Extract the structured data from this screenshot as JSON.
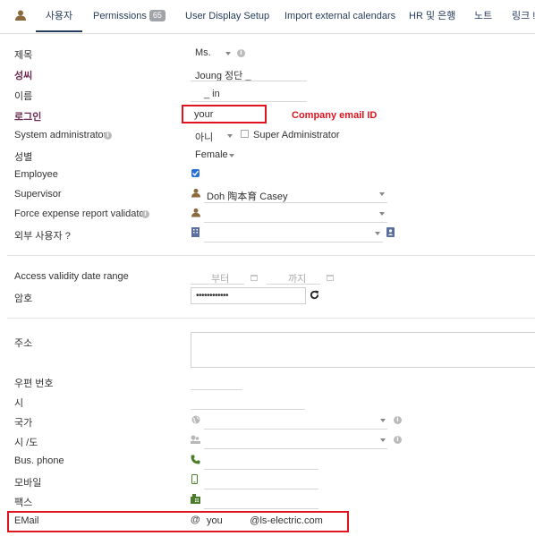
{
  "tabs": [
    {
      "label": "사용자",
      "active": true
    },
    {
      "label": "Permissions",
      "badge": "65"
    },
    {
      "label": "User Display Setup"
    },
    {
      "label": "Import external calendars"
    },
    {
      "label": "HR 및 은행"
    },
    {
      "label": "노트"
    },
    {
      "label": "링크 !"
    }
  ],
  "fields": {
    "title": {
      "label": "제목",
      "value": "Ms."
    },
    "lastname": {
      "label": "성씨",
      "value": "Joung 정단 _"
    },
    "firstname": {
      "label": "이름",
      "value": "_ in"
    },
    "login": {
      "label": "로그인",
      "value": "your"
    },
    "sysadmin": {
      "label": "System administrator",
      "value": "아니",
      "superadmin": "Super Administrator"
    },
    "gender": {
      "label": "성별",
      "value": "Female"
    },
    "employee": {
      "label": "Employee"
    },
    "supervisor": {
      "label": "Supervisor",
      "value": "Doh 陶本育 Casey"
    },
    "expense_validator": {
      "label": "Force expense report validator",
      "value": ""
    },
    "external_user": {
      "label": "외부 사용자 ?",
      "value": ""
    },
    "validity": {
      "label": "Access validity date range",
      "from": "부터",
      "to": "까지"
    },
    "password": {
      "label": "암호",
      "value": "••••••••••••"
    },
    "address": {
      "label": "주소",
      "value": ""
    },
    "zip": {
      "label": "우편 번호",
      "value": ""
    },
    "city": {
      "label": "시",
      "value": ""
    },
    "country": {
      "label": "국가",
      "value": ""
    },
    "state": {
      "label": "시 /도",
      "value": ""
    },
    "bus_phone": {
      "label": "Bus. phone",
      "value": ""
    },
    "mobile": {
      "label": "모바일",
      "value": ""
    },
    "fax": {
      "label": "팩스",
      "value": ""
    },
    "email": {
      "label": "EMail",
      "value": "you          @ls-electric.com"
    }
  },
  "annotation": {
    "text": "Company email ID"
  },
  "colors": {
    "accent": "#263c5c",
    "highlight": "#e0141e",
    "label_bold": "#6b2a52",
    "icon": "#8a6a3c"
  }
}
